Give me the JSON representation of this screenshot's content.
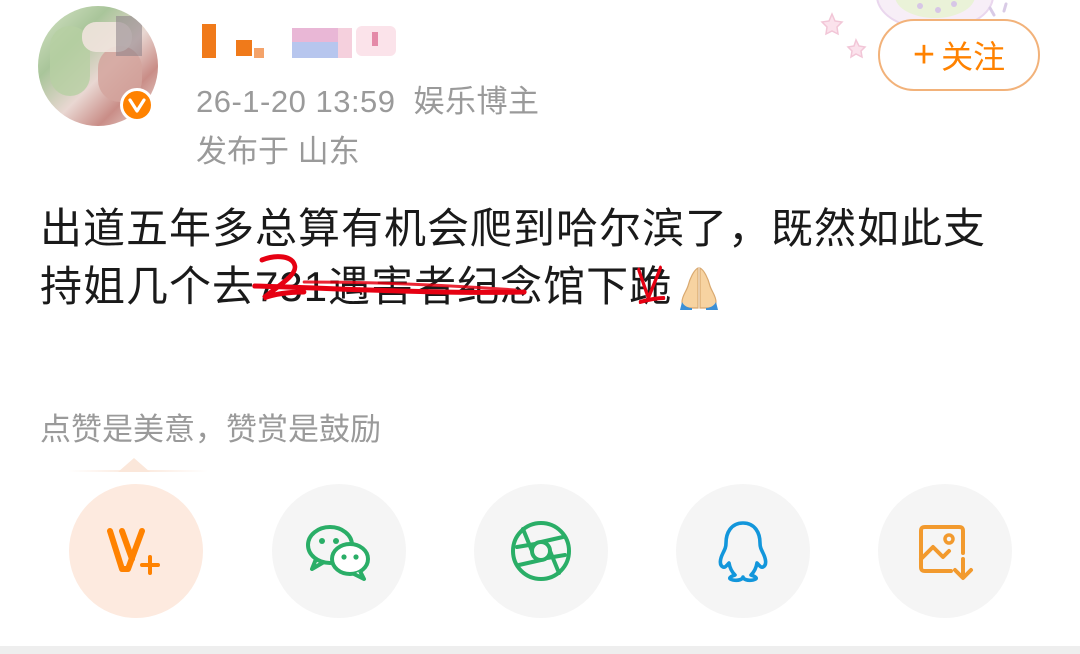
{
  "header": {
    "timestamp": "26-1-20 13:59",
    "role": "娱乐博主",
    "location": "发布于 山东",
    "follow_plus": "+",
    "follow_label": "关注"
  },
  "post": {
    "line1": "出道五年多总算有机会爬到哈尔滨了，既然如此支",
    "line2_prefix": "持姐几个去",
    "line2_struck": "731遇害者纪念馆",
    "line2_after": "下跪",
    "emoji": "folded-hands-emoji"
  },
  "reward": {
    "text": "点赞是美意，赞赏是鼓励"
  },
  "share": [
    {
      "name": "weibo-reward",
      "icon": "v-plus-icon",
      "color": "#ff8200"
    },
    {
      "name": "wechat",
      "icon": "wechat-icon",
      "color": "#2aae67"
    },
    {
      "name": "moments",
      "icon": "wechat-moments-icon",
      "color": "#2aae67"
    },
    {
      "name": "qq",
      "icon": "qq-icon",
      "color": "#1296db"
    },
    {
      "name": "save-image",
      "icon": "save-image-icon",
      "color": "#f29a2e"
    }
  ],
  "colors": {
    "accent": "#ff8200",
    "meta_text": "#9a9a9a",
    "strike": "#e60012"
  }
}
